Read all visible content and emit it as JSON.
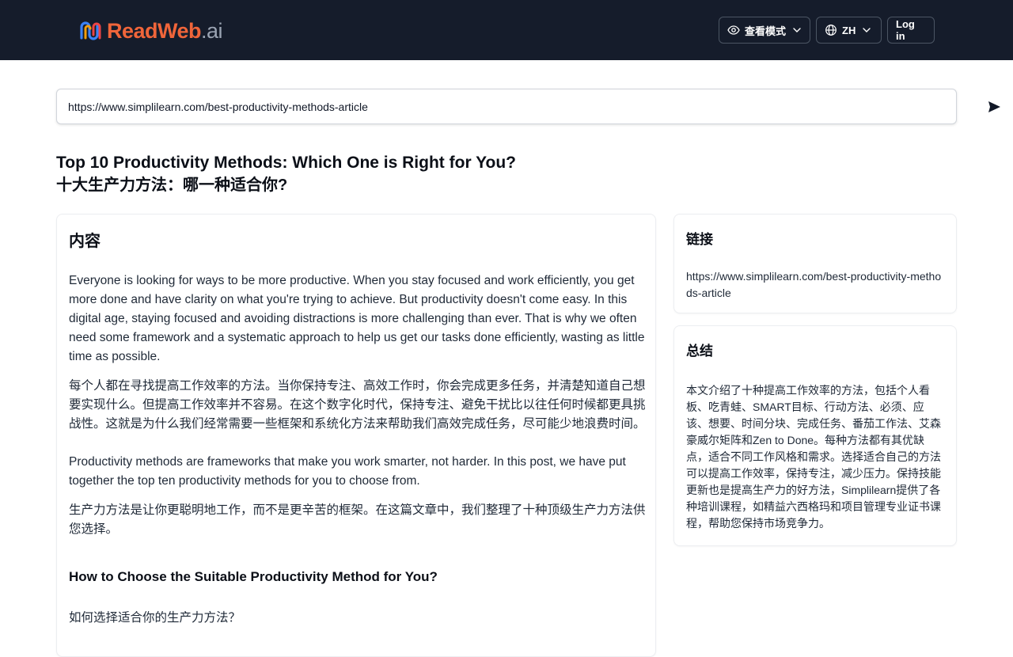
{
  "header": {
    "logo": {
      "read": "ReadWeb",
      "ai": ".ai"
    },
    "view_mode_label": "查看模式",
    "language_label": "ZH",
    "login_label": "Log in"
  },
  "url_bar": {
    "value": "https://www.simplilearn.com/best-productivity-methods-article"
  },
  "article": {
    "title_en": "Top 10 Productivity Methods: Which One is Right for You?",
    "title_zh": "十大生产力方法：哪一种适合你?"
  },
  "content": {
    "heading": "内容",
    "paragraphs": [
      {
        "en": "Everyone is looking for ways to be more productive. When you stay focused and work efficiently, you get more done and have clarity on what you're trying to achieve. But productivity doesn't come easy. In this digital age, staying focused and avoiding distractions is more challenging than ever. That is why we often need some framework and a systematic approach to help us get our tasks done efficiently, wasting as little time as possible.",
        "zh": "每个人都在寻找提高工作效率的方法。当你保持专注、高效工作时，你会完成更多任务，并清楚知道自己想要实现什么。但提高工作效率并不容易。在这个数字化时代，保持专注、避免干扰比以往任何时候都更具挑战性。这就是为什么我们经常需要一些框架和系统化方法来帮助我们高效完成任务，尽可能少地浪费时间。"
      },
      {
        "en": "Productivity methods are frameworks that make you work smarter, not harder. In this post, we have put together the top ten productivity methods for you to choose from.",
        "zh": "生产力方法是让你更聪明地工作，而不是更辛苦的框架。在这篇文章中，我们整理了十种顶级生产力方法供您选择。"
      }
    ],
    "section_heading": "How to Choose the Suitable Productivity Method for You?",
    "section_next_zh": "如何选择适合你的生产力方法？"
  },
  "link_card": {
    "heading": "链接",
    "url": "https://www.simplilearn.com/best-productivity-methods-article"
  },
  "summary_card": {
    "heading": "总结",
    "text": "本文介绍了十种提高工作效率的方法，包括个人看板、吃青蛙、SMART目标、行动方法、必须、应该、想要、时间分块、完成任务、番茄工作法、艾森豪威尔矩阵和Zen to Done。每种方法都有其优缺点，适合不同工作风格和需求。选择适合自己的方法可以提高工作效率，保持专注，减少压力。保持技能更新也是提高生产力的好方法，Simplilearn提供了各种培训课程，如精益六西格玛和项目管理专业证书课程，帮助您保持市场竞争力。"
  },
  "colors": {
    "topbar": "#151c2b",
    "brand": "#f0653a",
    "text": "#111827"
  },
  "icons": {
    "view_mode": "eye-icon",
    "language": "globe-icon",
    "dropdown": "chevron-down-icon",
    "send": "send-icon"
  }
}
